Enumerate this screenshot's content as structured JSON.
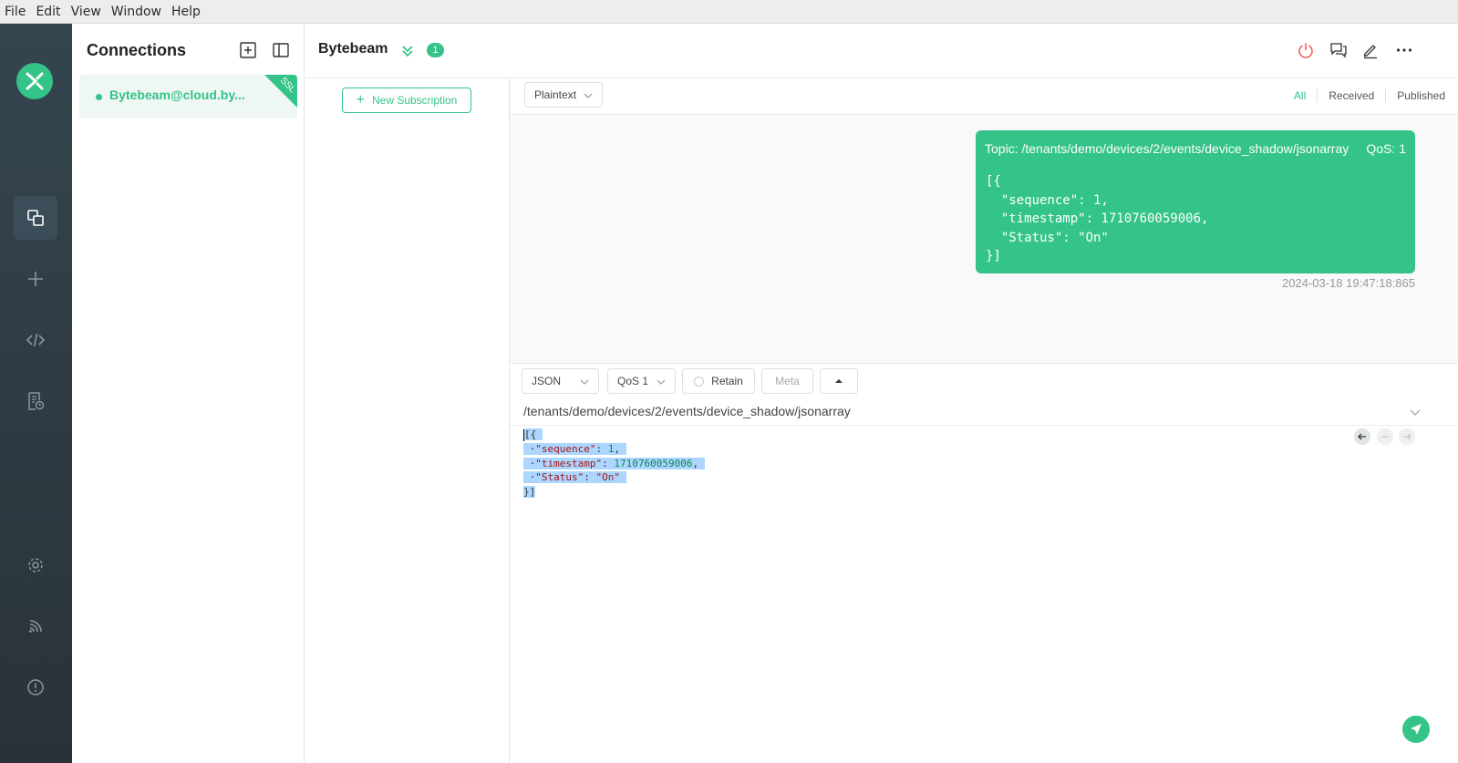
{
  "menu": [
    "File",
    "Edit",
    "View",
    "Window",
    "Help"
  ],
  "sidebar": {
    "title": "Connections",
    "connections": [
      {
        "name": "Bytebeam@cloud.by...",
        "ssl": "SSL",
        "status": "connected"
      }
    ]
  },
  "header": {
    "connection_name": "Bytebeam",
    "badge_count": "1"
  },
  "subscriptions": {
    "new_button_label": "New Subscription"
  },
  "filter": {
    "payload_format": "Plaintext",
    "tabs": [
      "All",
      "Received",
      "Published"
    ],
    "active_tab": "All"
  },
  "messages": [
    {
      "topic": "Topic: /tenants/demo/devices/2/events/device_shadow/jsonarray",
      "qos": "QoS: 1",
      "payload_lines": [
        "[{",
        "  \"sequence\": 1,",
        "  \"timestamp\": 1710760059006,",
        "  \"Status\": \"On\"",
        "}]"
      ],
      "time": "2024-03-18 19:47:18:865",
      "direction": "published"
    }
  ],
  "publish": {
    "format": "JSON",
    "qos": "QoS 1",
    "retain_label": "Retain",
    "meta_label": "Meta",
    "topic": "/tenants/demo/devices/2/events/device_shadow/jsonarray"
  },
  "colors": {
    "accent": "#34c388",
    "nav_bg": "#2f3c44",
    "selection": "#add6ff"
  }
}
